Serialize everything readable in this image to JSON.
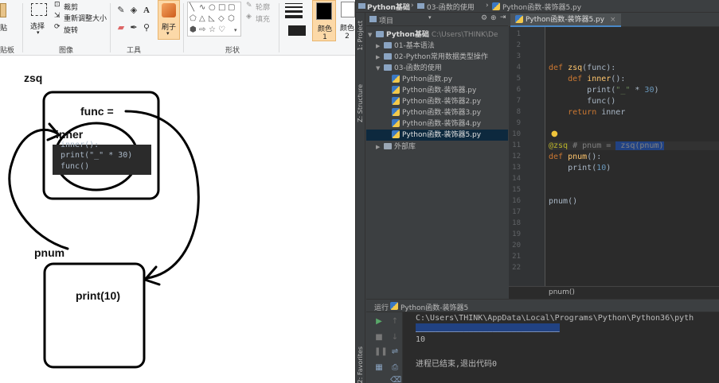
{
  "paint": {
    "ribbon": {
      "clipboard_paste_part": "贴",
      "clipboard_label": "贴板",
      "image": {
        "select_label": "选择",
        "crop_label": "裁剪",
        "resize_label": "重新调整大小",
        "rotate_label": "旋转",
        "group_label": "图像"
      },
      "tools": {
        "group_label": "工具"
      },
      "brush_label": "刷子",
      "shapes": {
        "outline_label": "轮廓",
        "fill_label": "填充",
        "group_label": "形状"
      },
      "size_label": "粗细",
      "color1_label": "颜色 1",
      "color2_label": "颜色 2",
      "color1": "#000000",
      "color2": "#ffffff"
    },
    "canvas": {
      "zsq_label": "zsq",
      "func_label": "func =",
      "inner_label": "inner",
      "inner_partial_line": "inner():",
      "inner_code_line1": "print(\"_\" * 30)",
      "inner_code_line2": "func()",
      "pnum_label": "pnum",
      "print_label": "print(10)"
    }
  },
  "ide": {
    "breadcrumbs": [
      "Python基础",
      "03-函数的使用",
      "Python函数-装饰器5.py"
    ],
    "project_panel": {
      "title": "项目",
      "vertical_tabs": [
        "1: Project",
        "Z: Structure",
        "2: Favorites"
      ],
      "tree": [
        {
          "label": "Python基础",
          "path": "C:\\Users\\THINK\\De"
        },
        {
          "label": "01-基本语法"
        },
        {
          "label": "02-Python常用数据类型操作"
        },
        {
          "label": "03-函数的使用"
        },
        {
          "label": "Python函数.py"
        },
        {
          "label": "Python函数-装饰器.py"
        },
        {
          "label": "Python函数-装饰器2.py"
        },
        {
          "label": "Python函数-装饰器3.py"
        },
        {
          "label": "Python函数-装饰器4.py"
        },
        {
          "label": "Python函数-装饰器5.py"
        },
        {
          "label": "外部库"
        }
      ]
    },
    "editor": {
      "tab_label": "Python函数-装饰器5.py",
      "line_numbers": [
        "1",
        "2",
        "3",
        "4",
        "5",
        "6",
        "7",
        "8",
        "9",
        "10",
        "11",
        "12",
        "13",
        "14",
        "15",
        "16",
        "17",
        "18",
        "19",
        "20",
        "21",
        "22"
      ],
      "code": {
        "l4_kw": "def",
        "l4_name": "zsq",
        "l4_rest": "(func):",
        "l5_kw": "def",
        "l5_name": "inner",
        "l5_rest": "():",
        "l6_a": "print(",
        "l6_str": "\"_\"",
        "l6_b": " * ",
        "l6_num": "30",
        "l6_c": ")",
        "l7": "func()",
        "l8_kw": "return",
        "l8_rest": " inner",
        "l11_dec": "@zsq",
        "l11_cm": " # pnum = ",
        "l11_hl": " zsq(pnum)",
        "l12_kw": "def",
        "l12_name": "pnum",
        "l12_rest": "():",
        "l13_a": "print(",
        "l13_num": "10",
        "l13_b": ")",
        "l16": "pnum()"
      },
      "footer_text": "pnum()"
    },
    "run_panel": {
      "title": "运行",
      "config_name": "Python函数-装饰器5",
      "output": {
        "command_line": "C:\\Users\\THINK\\AppData\\Local\\Programs\\Python\\Python36\\pyth",
        "separator_line": "______________________________",
        "value_line": "10",
        "exit_line": "进程已结束,退出代码0"
      }
    }
  }
}
